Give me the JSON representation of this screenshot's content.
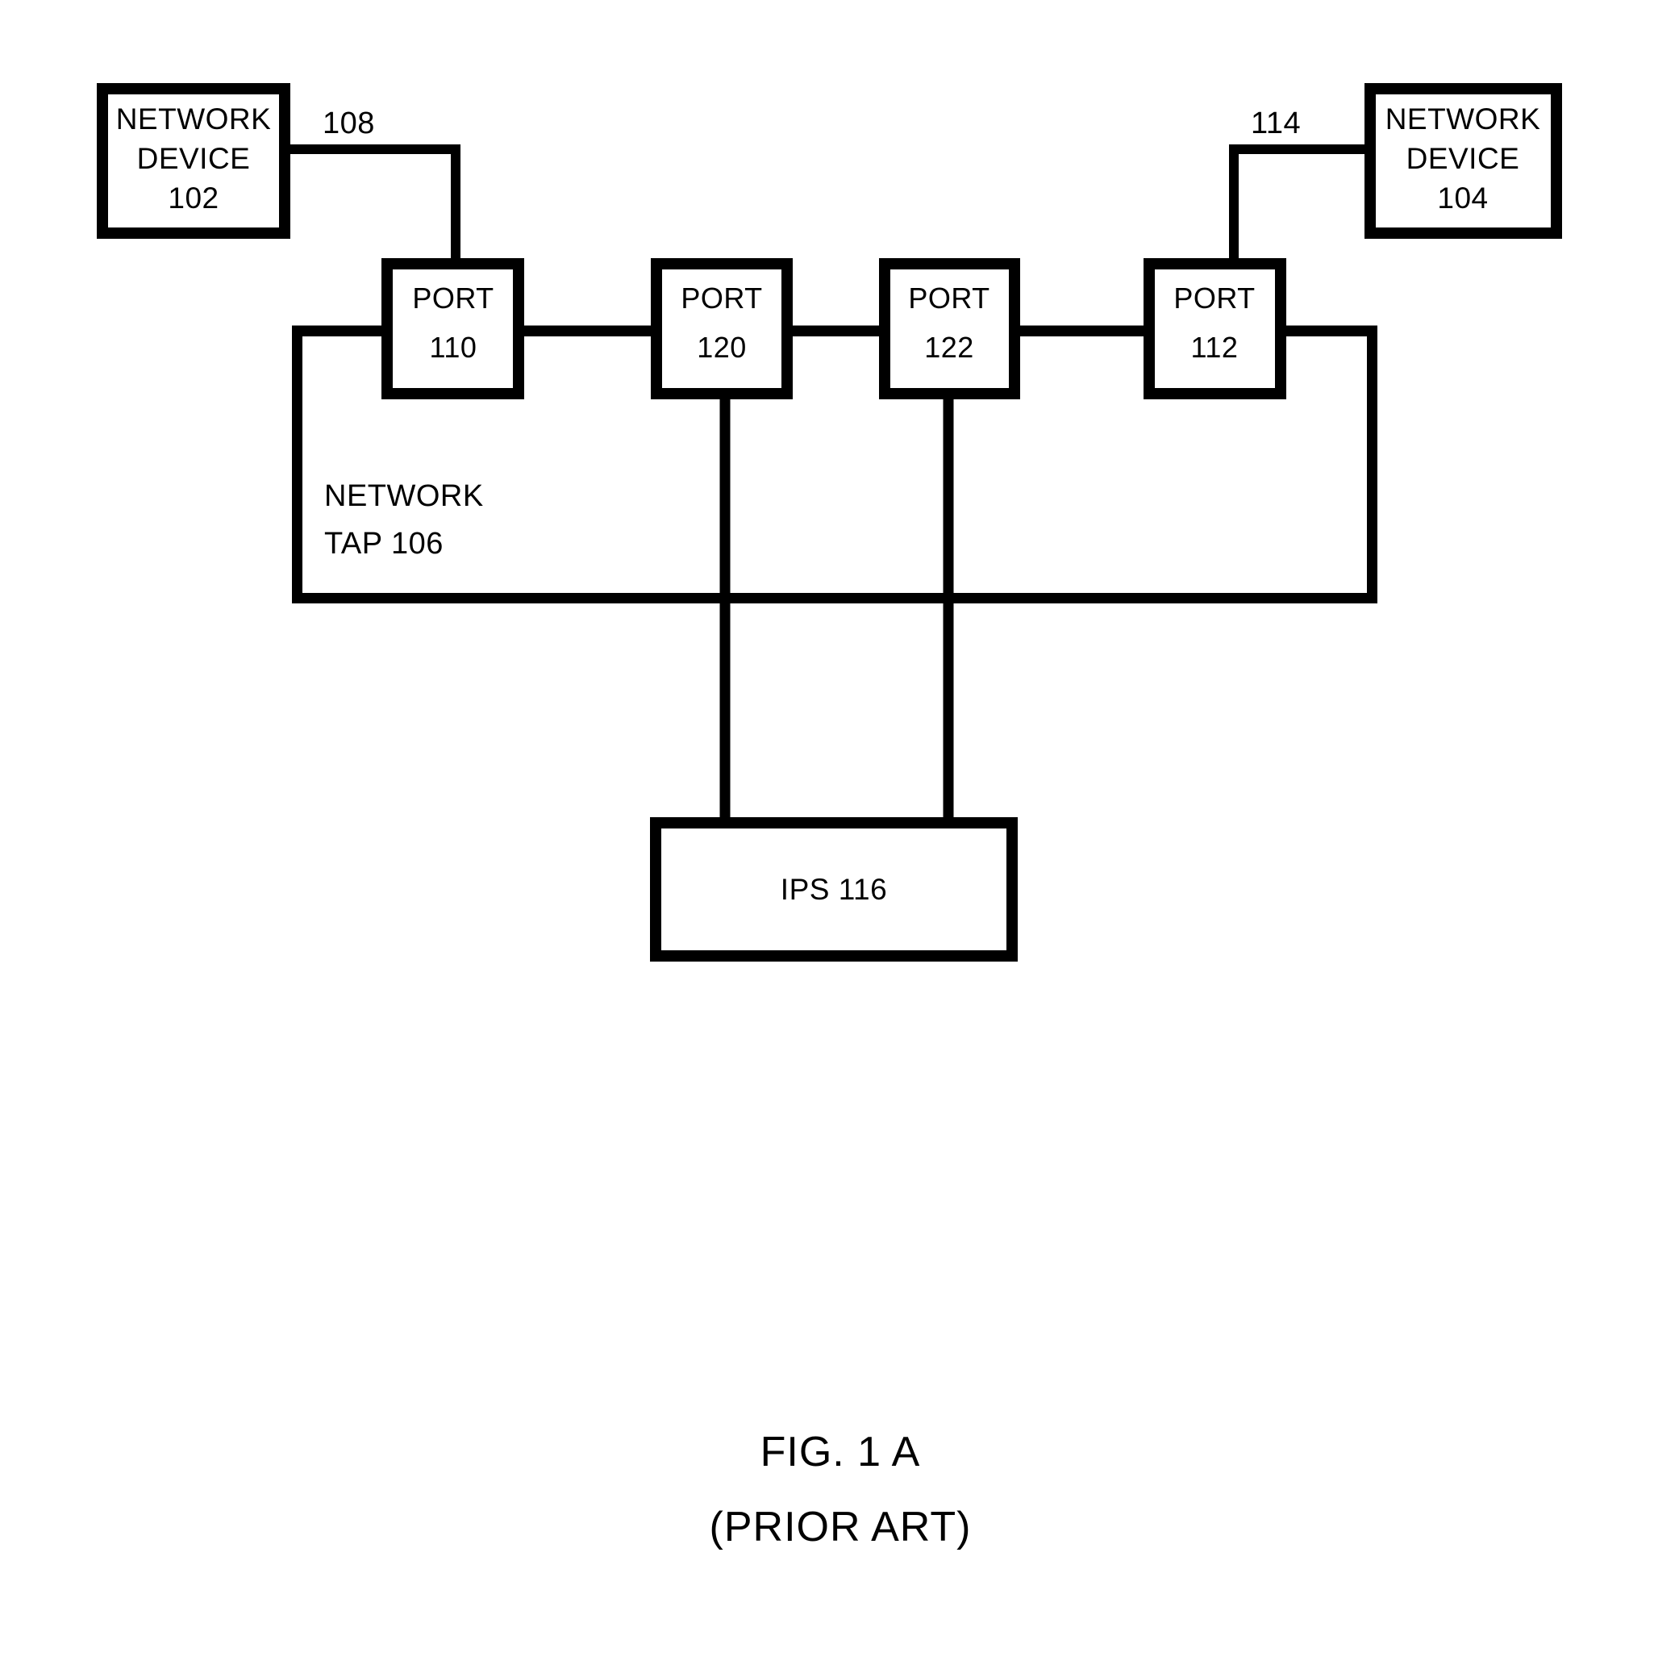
{
  "figure": {
    "caption_line1": "FIG. 1 A",
    "caption_line2": "(PRIOR ART)"
  },
  "devices": {
    "left": {
      "line1": "NETWORK",
      "line2": "DEVICE",
      "line3": "102"
    },
    "right": {
      "line1": "NETWORK",
      "line2": "DEVICE",
      "line3": "104"
    }
  },
  "tap": {
    "label_line1": "NETWORK",
    "label_line2": "TAP 106"
  },
  "ips": {
    "label": "IPS 116"
  },
  "ports": [
    {
      "line1": "PORT",
      "line2": "110"
    },
    {
      "line1": "PORT",
      "line2": "120"
    },
    {
      "line1": "PORT",
      "line2": "122"
    },
    {
      "line1": "PORT",
      "line2": "112"
    }
  ],
  "connectors": {
    "left_link": "108",
    "right_link": "114"
  },
  "colors": {
    "line": "#000000",
    "fill": "#ffffff",
    "background": "#ffffff"
  }
}
